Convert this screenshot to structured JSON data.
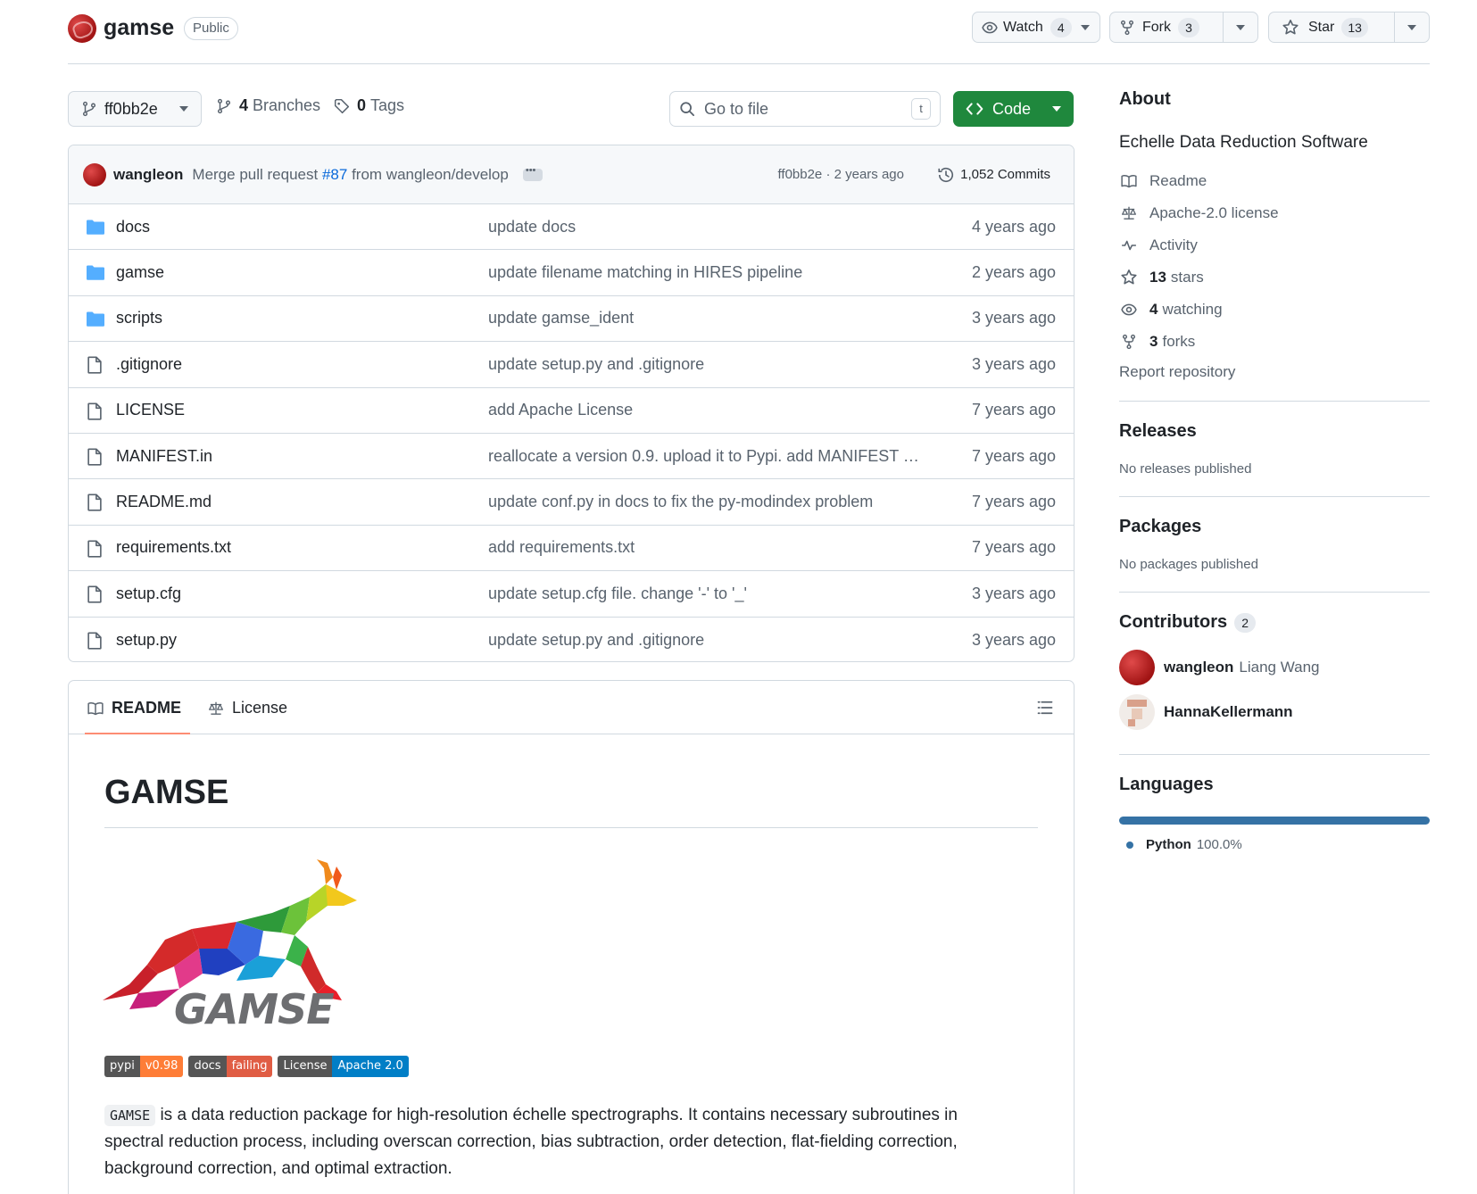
{
  "header": {
    "repo_name": "gamse",
    "visibility": "Public",
    "watch_label": "Watch",
    "watch_count": "4",
    "fork_label": "Fork",
    "fork_count": "3",
    "star_label": "Star",
    "star_count": "13"
  },
  "toolbar": {
    "branch": "ff0bb2e",
    "branches_count": "4",
    "branches_label": "Branches",
    "tags_count": "0",
    "tags_label": "Tags",
    "goto_placeholder": "Go to file",
    "goto_kbd": "t",
    "code_label": "Code"
  },
  "commit": {
    "author": "wangleon",
    "message_pre": "Merge pull request",
    "pr_link": "#87",
    "message_post": "from wangleon/develop",
    "meta": "ff0bb2e · 2 years ago",
    "count": "1,052 Commits"
  },
  "files": [
    {
      "name": "docs",
      "type": "dir",
      "message": "update docs",
      "time": "4 years ago"
    },
    {
      "name": "gamse",
      "type": "dir",
      "message": "update filename matching in HIRES pipeline",
      "time": "2 years ago"
    },
    {
      "name": "scripts",
      "type": "dir",
      "message": "update gamse_ident",
      "time": "3 years ago"
    },
    {
      "name": ".gitignore",
      "type": "file",
      "message": "update setup.py and .gitignore",
      "time": "3 years ago"
    },
    {
      "name": "LICENSE",
      "type": "file",
      "message": "add Apache License",
      "time": "7 years ago"
    },
    {
      "name": "MANIFEST.in",
      "type": "file",
      "message": "reallocate a version 0.9. upload it to Pypi. add MANIFEST a…",
      "time": "7 years ago"
    },
    {
      "name": "README.md",
      "type": "file",
      "message": "update conf.py in docs to fix the py-modindex problem",
      "time": "7 years ago"
    },
    {
      "name": "requirements.txt",
      "type": "file",
      "message": "add requirements.txt",
      "time": "7 years ago"
    },
    {
      "name": "setup.cfg",
      "type": "file",
      "message": "update setup.cfg file. change '-' to '_'",
      "time": "3 years ago"
    },
    {
      "name": "setup.py",
      "type": "file",
      "message": "update setup.py and .gitignore",
      "time": "3 years ago"
    }
  ],
  "readme": {
    "tab_readme": "README",
    "tab_license": "License",
    "title": "GAMSE",
    "logo_text": "GAMSE",
    "badges": [
      {
        "left": "pypi",
        "right": "v0.98",
        "color": "#fe7d37"
      },
      {
        "left": "docs",
        "right": "failing",
        "color": "#e05d44"
      },
      {
        "left": "License",
        "right": "Apache 2.0",
        "color": "#007ec6"
      }
    ],
    "code_word": "GAMSE",
    "body": "is a data reduction package for high-resolution échelle spectrographs. It contains necessary subroutines in spectral reduction process, including overscan correction, bias subtraction, order detection, flat-fielding correction, background correction, and optimal extraction."
  },
  "about": {
    "title": "About",
    "description": "Echelle Data Reduction Software",
    "readme": "Readme",
    "license": "Apache-2.0 license",
    "activity": "Activity",
    "stars_count": "13",
    "stars_label": "stars",
    "watching_count": "4",
    "watching_label": "watching",
    "forks_count": "3",
    "forks_label": "forks",
    "report": "Report repository"
  },
  "releases": {
    "title": "Releases",
    "text": "No releases published"
  },
  "packages": {
    "title": "Packages",
    "text": "No packages published"
  },
  "contributors": {
    "title": "Contributors",
    "count": "2",
    "list": [
      {
        "login": "wangleon",
        "name": "Liang Wang"
      },
      {
        "login": "HannaKellermann",
        "name": ""
      }
    ]
  },
  "languages": {
    "title": "Languages",
    "items": [
      {
        "name": "Python",
        "percent": "100.0%",
        "color": "#3572A5"
      }
    ]
  }
}
